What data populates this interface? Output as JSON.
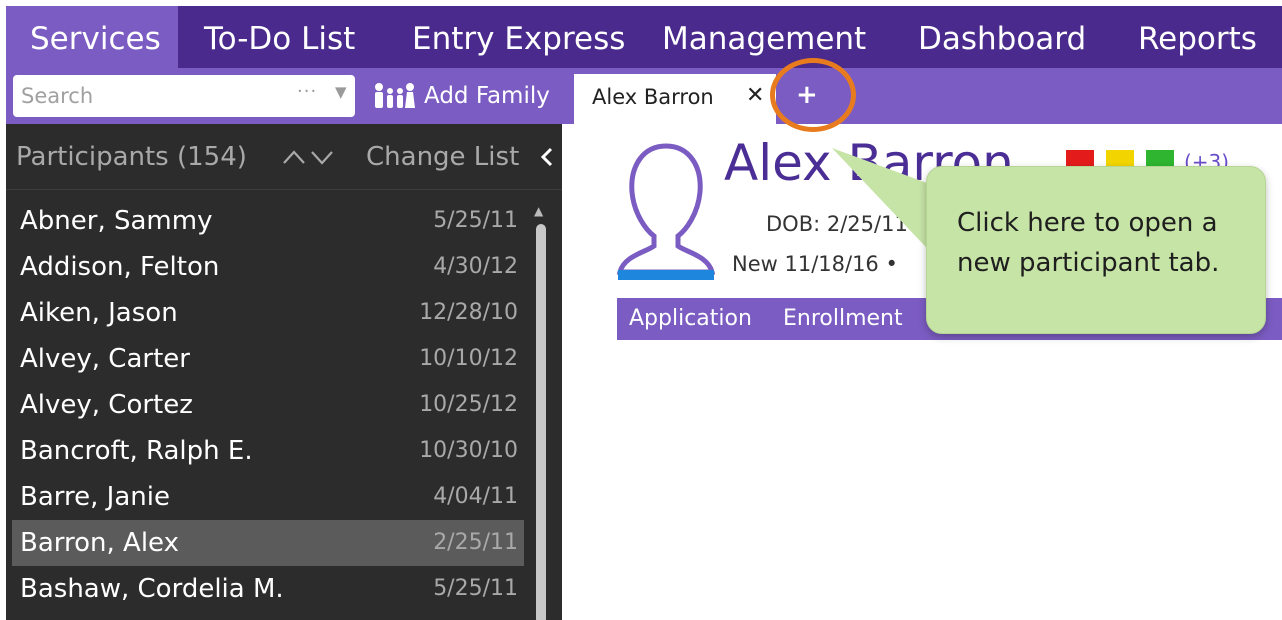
{
  "nav": {
    "items": [
      "Services",
      "To-Do List",
      "Entry Express",
      "Management",
      "Dashboard",
      "Reports"
    ],
    "active": "Services"
  },
  "toolbar": {
    "search_placeholder": "Search",
    "search_dots": "···",
    "add_family_label": "Add Family"
  },
  "tabs": {
    "open_tab_label": "Alex Barron",
    "close_glyph": "✕",
    "add_glyph": "+"
  },
  "sidebar": {
    "title": "Participants (154)",
    "change_list_label": "Change List",
    "participants": [
      {
        "name": "Abner, Sammy",
        "date": "5/25/11"
      },
      {
        "name": "Addison, Felton",
        "date": "4/30/12"
      },
      {
        "name": "Aiken, Jason",
        "date": "12/28/10"
      },
      {
        "name": "Alvey, Carter",
        "date": "10/10/12"
      },
      {
        "name": "Alvey, Cortez",
        "date": "10/25/12"
      },
      {
        "name": "Bancroft, Ralph E.",
        "date": "10/30/10"
      },
      {
        "name": "Barre, Janie",
        "date": "4/04/11"
      },
      {
        "name": "Barron, Alex",
        "date": "2/25/11",
        "selected": true
      },
      {
        "name": "Bashaw, Cordelia M.",
        "date": "5/25/11"
      }
    ]
  },
  "profile": {
    "name": "Alex Barron",
    "flags_count": "(+3)",
    "dob": "DOB: 2/25/11",
    "status": "New  11/18/16 •",
    "subtabs": [
      "Application",
      "Enrollment"
    ]
  },
  "callout": {
    "text": "Click here to open a new participant tab."
  },
  "colors": {
    "nav_bg": "#4a2a8c",
    "accent": "#7b5cc2",
    "sidebar_bg": "#2c2c2c",
    "highlight": "#e87b1e",
    "callout_bg": "#c7e4a7",
    "flag_red": "#e31b1b",
    "flag_yellow": "#f2d400",
    "flag_green": "#2fb52f"
  }
}
